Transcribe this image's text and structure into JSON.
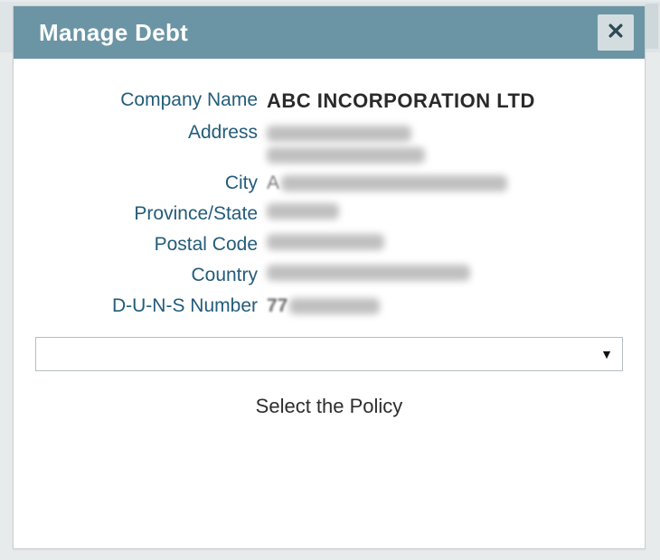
{
  "dialog": {
    "title": "Manage Debt",
    "close_icon": "close-icon"
  },
  "fields": {
    "company_name": {
      "label": "Company Name",
      "value": "ABC INCORPORATION LTD"
    },
    "address": {
      "label": "Address",
      "value_redacted": true
    },
    "city": {
      "label": "City",
      "value_redacted": true,
      "first_char": "A"
    },
    "province": {
      "label": "Province/State",
      "value_redacted": true
    },
    "postal_code": {
      "label": "Postal Code",
      "value_redacted": true
    },
    "country": {
      "label": "Country",
      "value_redacted": true
    },
    "duns": {
      "label": "D-U-N-S Number",
      "value_redacted": true,
      "visible_prefix": "77"
    }
  },
  "policy_select": {
    "selected": "",
    "caption": "Select the Policy"
  }
}
